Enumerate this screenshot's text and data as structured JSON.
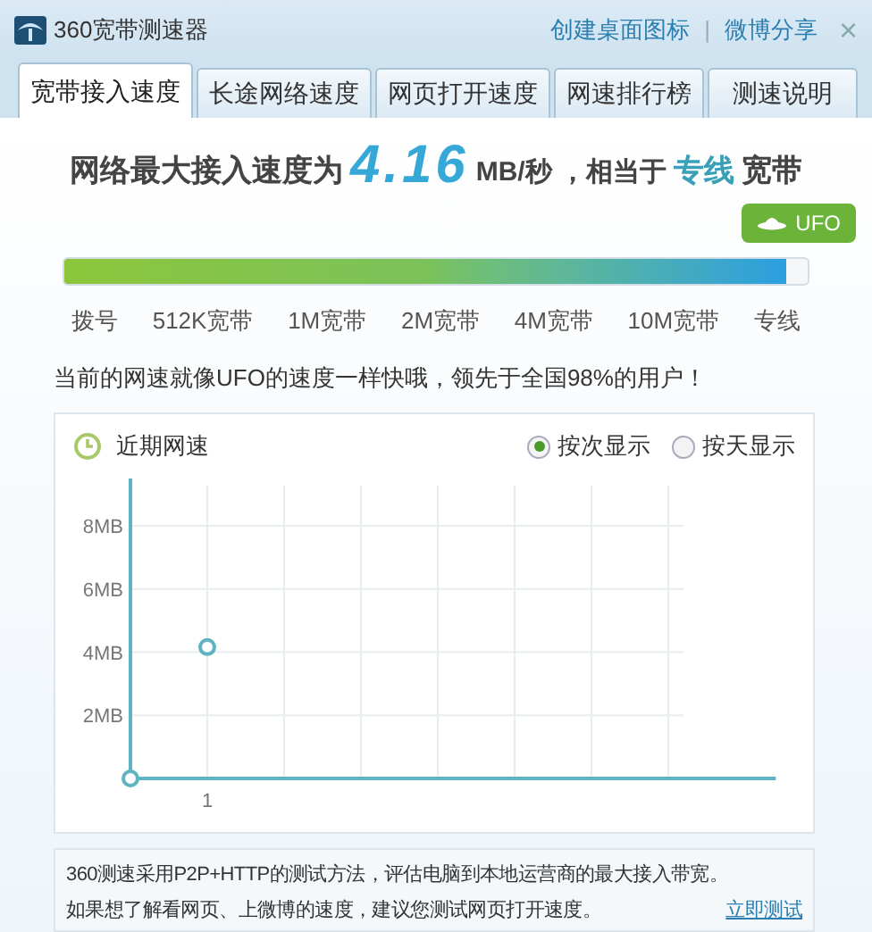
{
  "window": {
    "title": "360宽带测速器",
    "links": [
      "创建桌面图标",
      "微博分享"
    ],
    "separator": "|",
    "close": "×"
  },
  "tabs": [
    {
      "label": "宽带接入速度",
      "selected": true
    },
    {
      "label": "长途网络速度",
      "selected": false
    },
    {
      "label": "网页打开速度",
      "selected": false
    },
    {
      "label": "网速排行榜",
      "selected": false
    },
    {
      "label": "测速说明",
      "selected": false
    }
  ],
  "result": {
    "prefix": "网络最大接入速度为",
    "speed": "4.16",
    "unit": "MB/秒 ，相当于",
    "grade": "专线",
    "suffix": "宽带"
  },
  "speed_bar": {
    "level": 0.97,
    "badge": "UFO",
    "scale": [
      "拨号",
      "512K宽带",
      "1M宽带",
      "2M宽带",
      "4M宽带",
      "10M宽带",
      "专线"
    ]
  },
  "comment": "当前的网速就像UFO的速度一样快哦，领先于全国98%的用户！",
  "history": {
    "title": "近期网速",
    "options": [
      {
        "label": "按次显示",
        "selected": true
      },
      {
        "label": "按天显示",
        "selected": false
      }
    ],
    "chart_data": {
      "type": "line",
      "categories": [
        "1"
      ],
      "series": [
        {
          "color": "#5fb3c2",
          "marker": "circle",
          "values": [
            4.16
          ]
        }
      ],
      "grid": true,
      "yticks": [
        {
          "value": 2,
          "label": "2MB"
        },
        {
          "value": 4,
          "label": "4MB"
        },
        {
          "value": 6,
          "label": "6MB"
        },
        {
          "value": 8,
          "label": "8MB"
        }
      ],
      "ylim": [
        0,
        9.5
      ]
    }
  },
  "note": {
    "lines": [
      "360测速采用P2P+HTTP的测试方法，评估电脑到本地运营商的最大接入带宽。",
      "如果想了解看网页、上微博的速度，建议您测试网页打开速度。"
    ],
    "link": "立即测试"
  }
}
